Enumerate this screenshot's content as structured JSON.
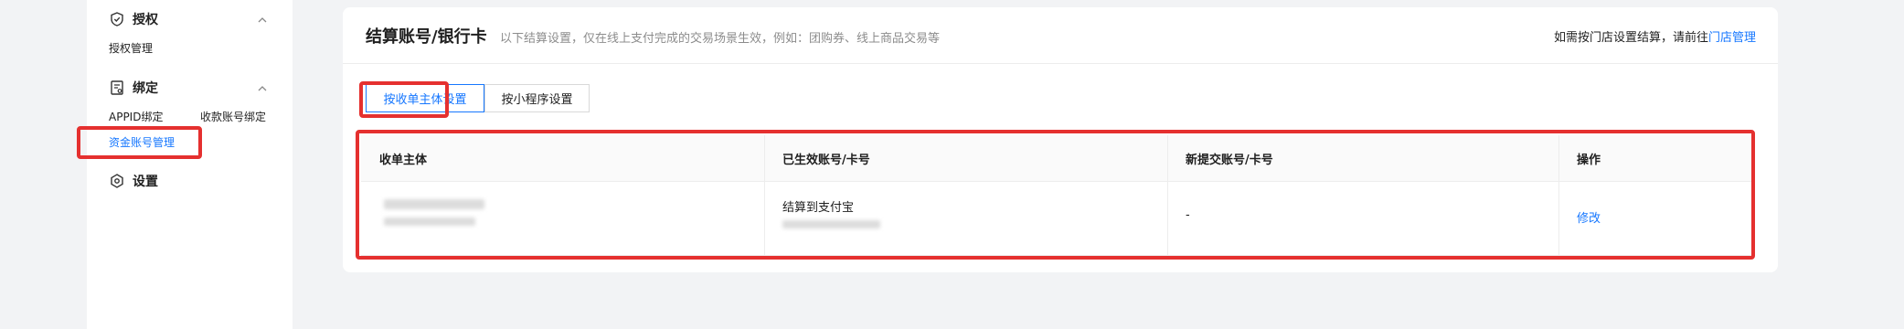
{
  "sidebar": {
    "groups": [
      {
        "title": "授权",
        "icon": "shield-check-icon",
        "items": [
          "授权管理"
        ]
      },
      {
        "title": "绑定",
        "icon": "bind-doc-icon",
        "items": [
          "APPID绑定",
          "收款账号绑定",
          "资金账号管理"
        ]
      },
      {
        "title": "设置",
        "icon": "settings-icon",
        "items": []
      }
    ],
    "active_item": "资金账号管理"
  },
  "header": {
    "title": "结算账号/银行卡",
    "description": "以下结算设置，仅在线上支付完成的交易场景生效，例如：团购券、线上商品交易等",
    "right_prefix": "如需按门店设置结算，请前往",
    "right_link": "门店管理"
  },
  "tabs": [
    {
      "label": "按收单主体设置",
      "active": true
    },
    {
      "label": "按小程序设置",
      "active": false
    }
  ],
  "table": {
    "columns": [
      "收单主体",
      "已生效账号/卡号",
      "新提交账号/卡号",
      "操作"
    ],
    "rows": [
      {
        "effective_account": "结算到支付宝",
        "new_account": "-",
        "action": "修改"
      }
    ]
  },
  "colors": {
    "accent": "#1677ff",
    "highlight": "#e5302f"
  }
}
